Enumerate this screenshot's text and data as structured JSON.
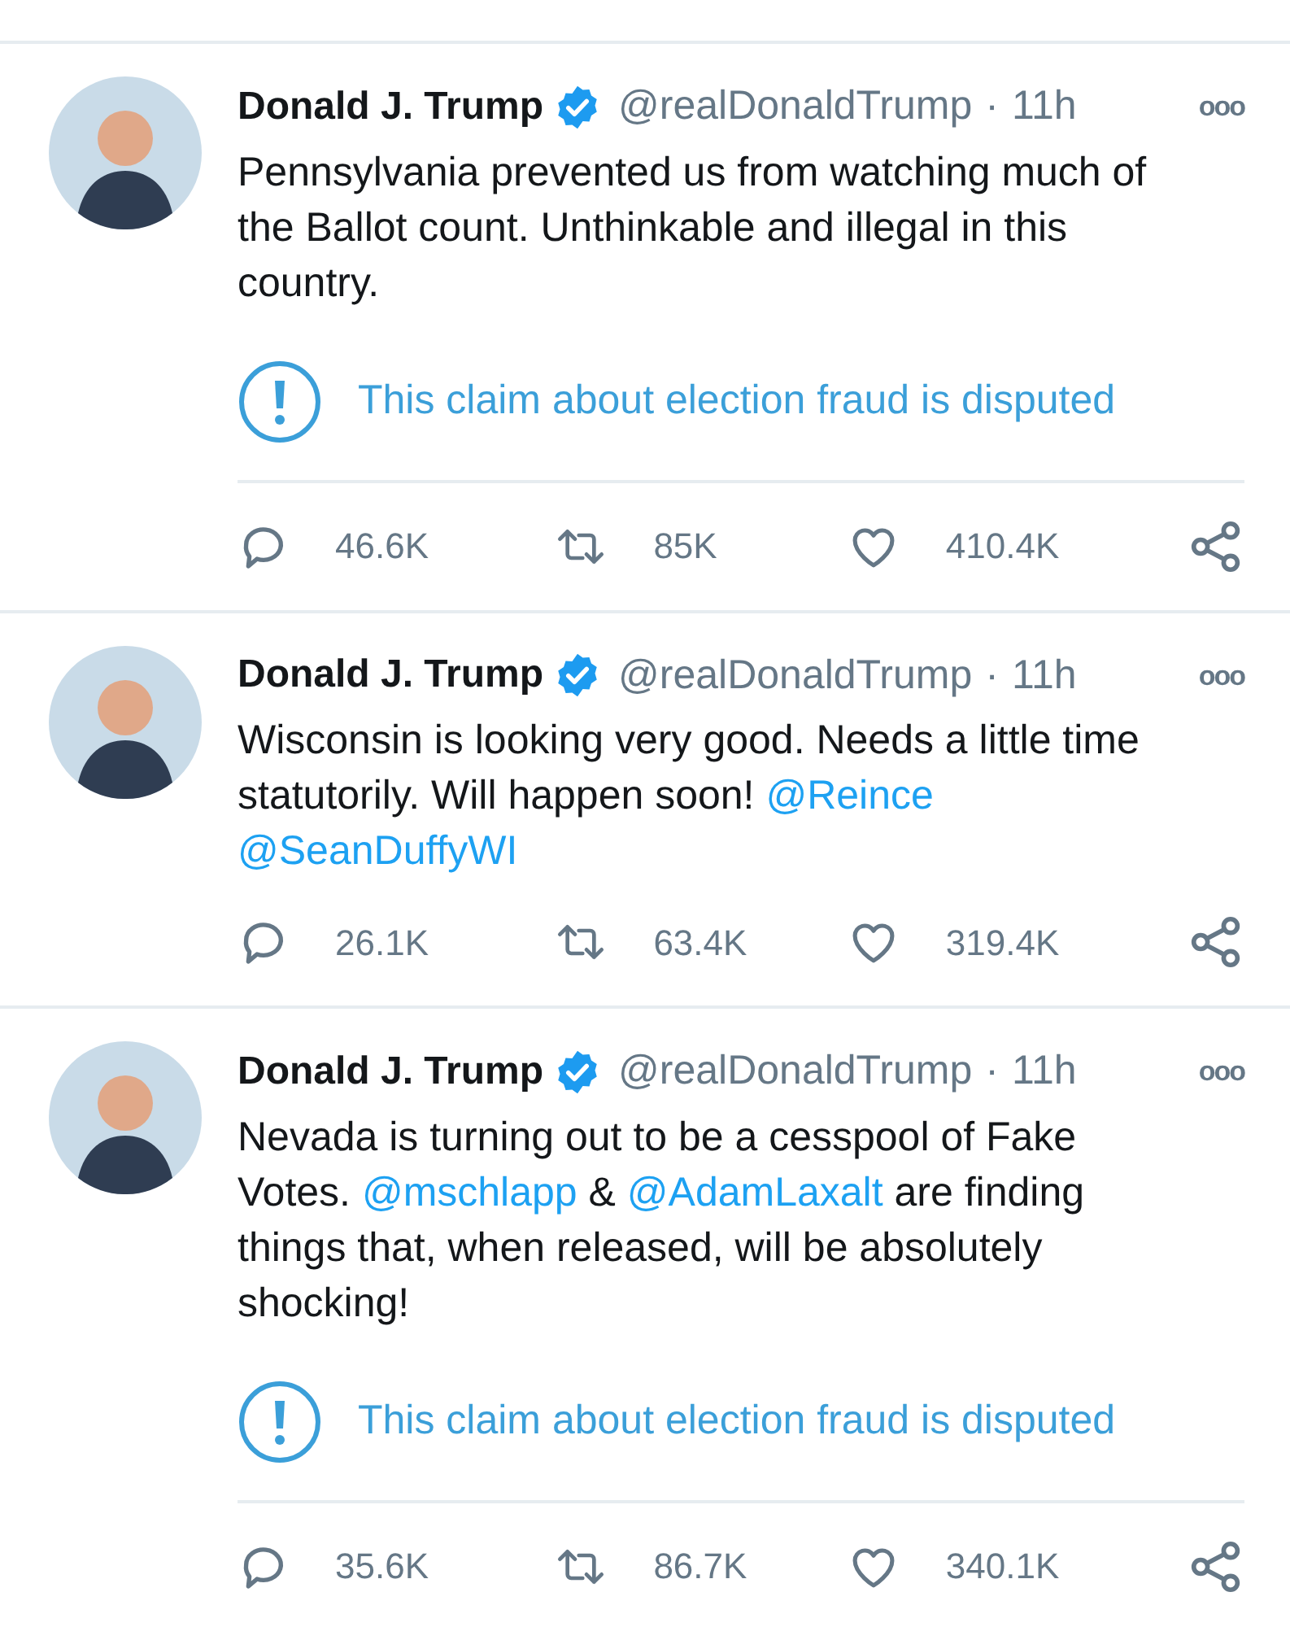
{
  "tweets": [
    {
      "name": "Donald J. Trump",
      "verified": true,
      "handle": "@realDonaldTrump",
      "separator": "·",
      "time": "11h",
      "more": "ooo",
      "body": [
        {
          "kind": "text",
          "text": "Pennsylvania prevented us from watching much of the Ballot count. Unthinkable and illegal in this country."
        }
      ],
      "notice": "This claim about election fraud is disputed",
      "replies": "46.6K",
      "retweets": "85K",
      "likes": "410.4K"
    },
    {
      "name": "Donald J. Trump",
      "verified": true,
      "handle": "@realDonaldTrump",
      "separator": "·",
      "time": "11h",
      "more": "ooo",
      "body": [
        {
          "kind": "text",
          "text": "Wisconsin is looking very good. Needs a little time statutorily. Will happen soon! "
        },
        {
          "kind": "mention",
          "text": "@Reince"
        },
        {
          "kind": "mention",
          "text": "@SeanDuffyWI"
        }
      ],
      "replies": "26.1K",
      "retweets": "63.4K",
      "likes": "319.4K"
    },
    {
      "name": "Donald J. Trump",
      "verified": true,
      "handle": "@realDonaldTrump",
      "separator": "·",
      "time": "11h",
      "more": "ooo",
      "body": [
        {
          "kind": "text",
          "text": "Nevada is turning out to be a cesspool of Fake Votes. "
        },
        {
          "kind": "mention",
          "text": "@mschlapp"
        },
        {
          "kind": "text",
          "text": " & "
        },
        {
          "kind": "mention",
          "text": "@AdamLaxalt"
        },
        {
          "kind": "text",
          "text": " are finding things that, when released, will be absolutely shocking!"
        }
      ],
      "notice": "This claim about election fraud is disputed",
      "replies": "35.6K",
      "retweets": "86.7K",
      "likes": "340.1K"
    }
  ]
}
